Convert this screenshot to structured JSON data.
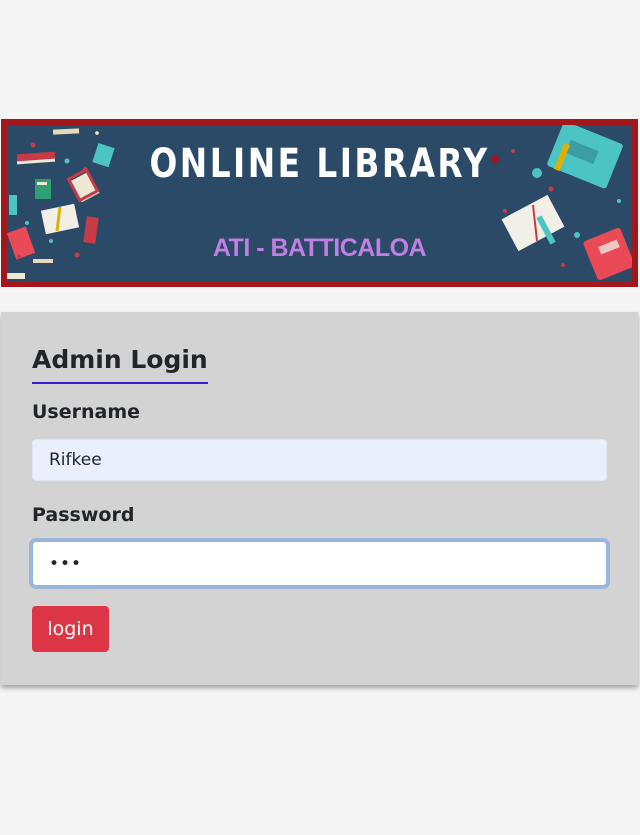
{
  "banner": {
    "title": "ONLINE LIBRARY",
    "subtitle": "ATI - BATTICALOA",
    "image": "books-illustration"
  },
  "login": {
    "heading": "Admin Login",
    "username_label": "Username",
    "username_value": "Rifkee",
    "password_label": "Password",
    "password_value": "•••",
    "button_label": "login"
  },
  "colors": {
    "page_background": "#f5f5f5",
    "banner_background": "#2b4a67",
    "banner_border": "#a3161b",
    "banner_subtitle": "#c17ee3",
    "card_background": "#d3d3d3",
    "heading_underline": "#3b1fd0",
    "username_field_background": "#e8f0fe",
    "button": "#dc3545"
  }
}
